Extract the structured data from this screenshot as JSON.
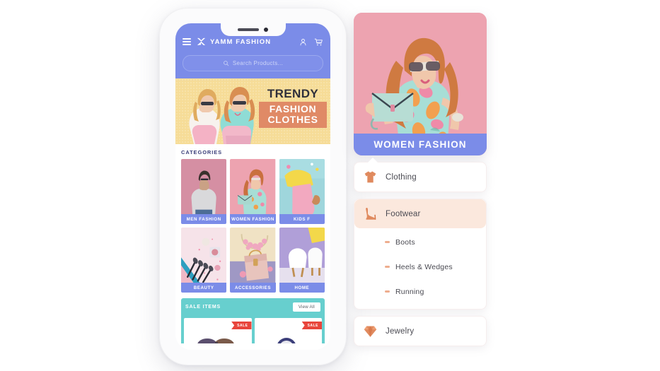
{
  "app": {
    "brand": "YAMM FASHION",
    "icons": {
      "menu": "hamburger-icon",
      "logo": "yamm-butterfly-logo",
      "account": "user-account-icon",
      "cart": "shopping-cart-icon",
      "search": "search-icon"
    },
    "search": {
      "placeholder": "Search Products...",
      "value": ""
    },
    "hero_banner": {
      "line1": "TRENDY",
      "line2": "FASHION",
      "line3": "CLOTHES",
      "bg_color": "#f6dc97",
      "accent_color": "#e08a66"
    },
    "categories": {
      "title": "CATEGORIES",
      "items": [
        {
          "label": "MEN FASHION",
          "bg": "#d58fa3"
        },
        {
          "label": "WOMEN FASHION",
          "bg": "#eda3b0"
        },
        {
          "label": "KIDS F",
          "bg": "#9fd6dc"
        },
        {
          "label": "BEAUTY",
          "bg": "#f3dde3"
        },
        {
          "label": "ACCESSORIES",
          "bg": "#efe0c2"
        },
        {
          "label": "HOME",
          "bg": "#b09fd8"
        }
      ]
    },
    "sale": {
      "title": "SALE ITEMS",
      "view_all": "View All",
      "bg_color": "#67cfce",
      "items": [
        {
          "ribbon": "SALE"
        },
        {
          "ribbon": "SALE"
        }
      ]
    }
  },
  "panel": {
    "hero_card": {
      "label": "WOMEN FASHION",
      "band_color": "#7b8ce8",
      "photo_bg": "#eda3b0"
    },
    "menu": [
      {
        "label": "Clothing",
        "icon": "tshirt-icon",
        "active": false,
        "children": []
      },
      {
        "label": "Footwear",
        "icon": "high-heel-shoe-icon",
        "active": true,
        "children": [
          {
            "label": "Boots"
          },
          {
            "label": "Heels & Wedges"
          },
          {
            "label": "Running"
          }
        ]
      },
      {
        "label": "Jewelry",
        "icon": "diamond-icon",
        "active": false,
        "children": []
      }
    ],
    "accent_color": "#e08a5e",
    "active_bg": "#fbe8dd"
  }
}
